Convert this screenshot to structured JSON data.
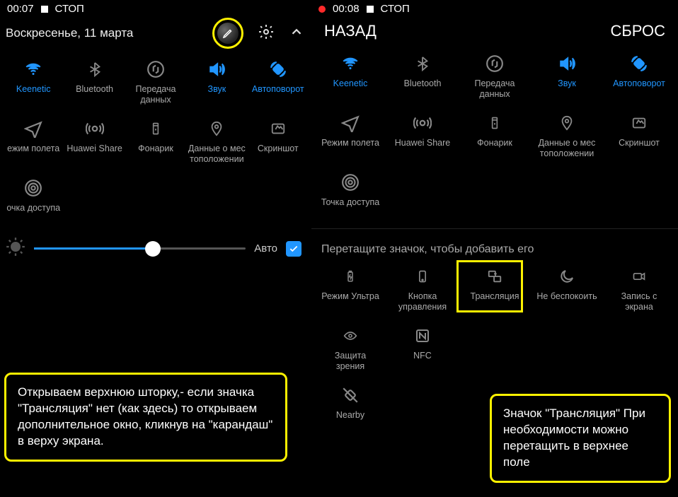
{
  "left": {
    "status": {
      "time": "00:07",
      "stop": "СТОП"
    },
    "date": "Воскресенье, 11 марта",
    "tiles_row1": [
      {
        "label": "Keenetic",
        "active": true
      },
      {
        "label": "Bluetooth",
        "active": false
      },
      {
        "label": "Передача данных",
        "active": false
      },
      {
        "label": "Звук",
        "active": true
      },
      {
        "label": "Автоповорот",
        "active": true
      }
    ],
    "tiles_row2": [
      {
        "label": "ежим полета"
      },
      {
        "label": "Huawei Share"
      },
      {
        "label": "Фонарик"
      },
      {
        "label": "Данные о мес тоположении"
      },
      {
        "label": "Скриншот"
      }
    ],
    "tiles_row3": [
      {
        "label": "очка доступа"
      }
    ],
    "auto_label": "Авто",
    "brightness_pct": 56,
    "annotation": "Открываем верхнюю шторку,- если значка \"Трансляция\" нет (как здесь) то открываем дополнительное окно, кликнув на \"карандаш\" в верху экрана."
  },
  "right": {
    "status": {
      "time": "00:08",
      "stop": "СТОП"
    },
    "back": "НАЗАД",
    "reset": "СБРОС",
    "tiles_row1": [
      {
        "label": "Keenetic",
        "active": true
      },
      {
        "label": "Bluetooth",
        "active": false
      },
      {
        "label": "Передача данных",
        "active": false
      },
      {
        "label": "Звук",
        "active": true
      },
      {
        "label": "Автоповорот",
        "active": true
      }
    ],
    "tiles_row2": [
      {
        "label": "Режим полета"
      },
      {
        "label": "Huawei Share"
      },
      {
        "label": "Фонарик"
      },
      {
        "label": "Данные о мес тоположении"
      },
      {
        "label": "Скриншот"
      }
    ],
    "tiles_row3": [
      {
        "label": "Точка доступа"
      }
    ],
    "drag_hint": "Перетащите значок, чтобы добавить его",
    "extra_row1": [
      {
        "label": "Режим Ультра"
      },
      {
        "label": "Кнопка управления"
      },
      {
        "label": "Трансляция"
      },
      {
        "label": "Не беспокоить"
      },
      {
        "label": "Запись с экрана"
      }
    ],
    "extra_row2": [
      {
        "label": "Защита зрения"
      },
      {
        "label": "NFC"
      }
    ],
    "extra_row3": [
      {
        "label": "Nearby"
      }
    ],
    "annotation": "Значок \"Трансляция\" При необходимости можно перетащить в верхнее поле"
  }
}
